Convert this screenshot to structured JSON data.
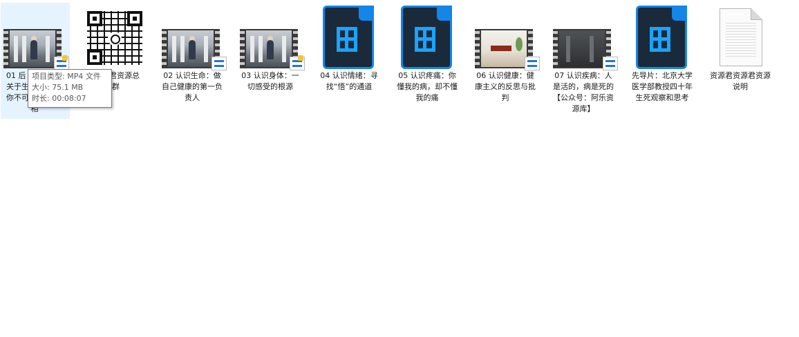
{
  "files": [
    {
      "name": "01 后面是什么？关于生命，你不可不知的真相",
      "display": "01 后",
      "display2": "关于生",
      "display3": "你不可",
      "display4": "相",
      "type": "video"
    },
    {
      "name": "资源君资源总群",
      "display": "君资源总",
      "display2": "群",
      "type": "qr"
    },
    {
      "name": "02 认识生命：做自己健康的第一负责人",
      "type": "video"
    },
    {
      "name": "03 认识身体：一切感受的根源",
      "type": "video"
    },
    {
      "name": "04 认识情绪：寻找“悟”的通道",
      "type": "video-doc"
    },
    {
      "name": "05 认识疼痛：你懂我的病，却不懂我的痛",
      "type": "video-doc"
    },
    {
      "name": "06 认识健康：健康主义的反思与批判",
      "type": "video"
    },
    {
      "name": "07 认识疾病：人是活的，病是死的【公众号：阿乐资源库】",
      "type": "video"
    },
    {
      "name": "先导片：北京大学医学部教授四十年生死观察和思考",
      "type": "video-doc"
    },
    {
      "name": "资源君资源君资源说明",
      "type": "doc"
    }
  ],
  "tooltip": {
    "type_line": "项目类型: MP4 文件",
    "size_line": "大小: 75.1 MB",
    "duration_line": "时长: 00:08:07"
  },
  "colors": {
    "selection": "#e5f3ff",
    "accent": "#1486e8",
    "badge_blue": "#1e78d6"
  }
}
